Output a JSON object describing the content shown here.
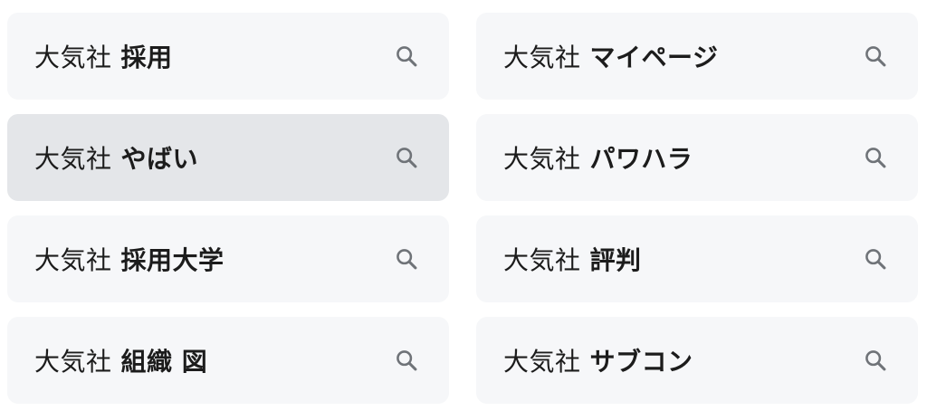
{
  "prefix": "大気社",
  "suggestions": [
    {
      "term": "採用"
    },
    {
      "term": "マイページ"
    },
    {
      "term": "やばい"
    },
    {
      "term": "パワハラ"
    },
    {
      "term": "採用大学"
    },
    {
      "term": "評判"
    },
    {
      "term": "組織 図"
    },
    {
      "term": "サブコン"
    }
  ],
  "icon": "search-icon",
  "colors": {
    "chip_background": "#f6f7f9",
    "chip_highlight": "#e4e6e9",
    "text": "#1c1c1c",
    "icon": "#6f7378"
  }
}
